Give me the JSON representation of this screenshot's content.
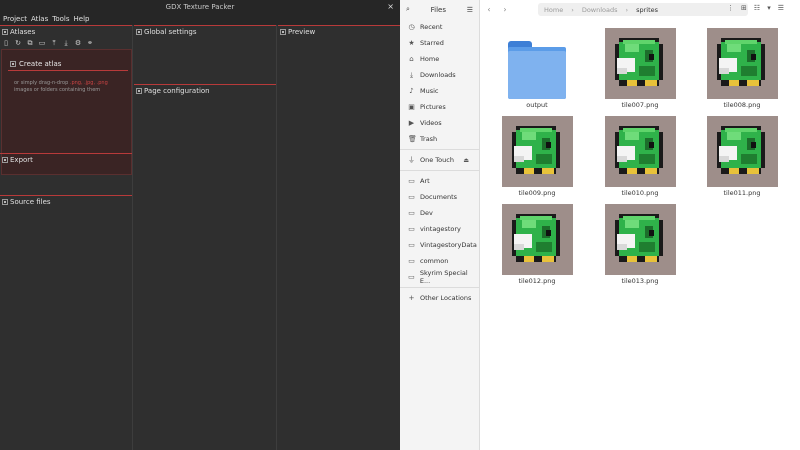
{
  "gdx": {
    "window_title": "GDX Texture Packer",
    "close_glyph": "×",
    "menu": [
      "Project",
      "Atlas",
      "Tools",
      "Help"
    ],
    "panels": {
      "atlases": "Atlases",
      "global_settings": "Global settings",
      "preview": "Preview",
      "page_configuration": "Page configuration",
      "export": "Export",
      "source_files": "Source files"
    },
    "create_atlas": "Create atlas",
    "hint_prefix": "or simply drag-n-drop ",
    "hint_exts": ".png, .jpg, .png",
    "hint_suffix": " images or folders containing them"
  },
  "files": {
    "app_title": "Files",
    "sidebar": {
      "places": [
        {
          "label": "Recent",
          "icon": "clock-icon"
        },
        {
          "label": "Starred",
          "icon": "star-icon"
        },
        {
          "label": "Home",
          "icon": "home-icon"
        },
        {
          "label": "Downloads",
          "icon": "download-icon"
        },
        {
          "label": "Music",
          "icon": "music-icon"
        },
        {
          "label": "Pictures",
          "icon": "picture-icon"
        },
        {
          "label": "Videos",
          "icon": "video-icon"
        },
        {
          "label": "Trash",
          "icon": "trash-icon"
        }
      ],
      "device": {
        "label": "One Touch",
        "icon": "usb-icon"
      },
      "bookmarks": [
        "Art",
        "Documents",
        "Dev",
        "vintagestory",
        "VintagestoryData",
        "common",
        "Skyrim Special E..."
      ],
      "other_locations": "Other Locations"
    },
    "breadcrumb": [
      "Home",
      "Downloads",
      "sprites"
    ],
    "items": [
      {
        "name": "output",
        "kind": "folder"
      },
      {
        "name": "tile007.png",
        "kind": "image"
      },
      {
        "name": "tile008.png",
        "kind": "image"
      },
      {
        "name": "tile009.png",
        "kind": "image"
      },
      {
        "name": "tile010.png",
        "kind": "image"
      },
      {
        "name": "tile011.png",
        "kind": "image"
      },
      {
        "name": "tile012.png",
        "kind": "image"
      },
      {
        "name": "tile013.png",
        "kind": "image"
      }
    ],
    "colors": {
      "folder": "#5b9ce8",
      "sprite_bg": "#9e8e8a",
      "sprite_green": "#2fb24a",
      "accent_red": "#b83a3a"
    }
  }
}
